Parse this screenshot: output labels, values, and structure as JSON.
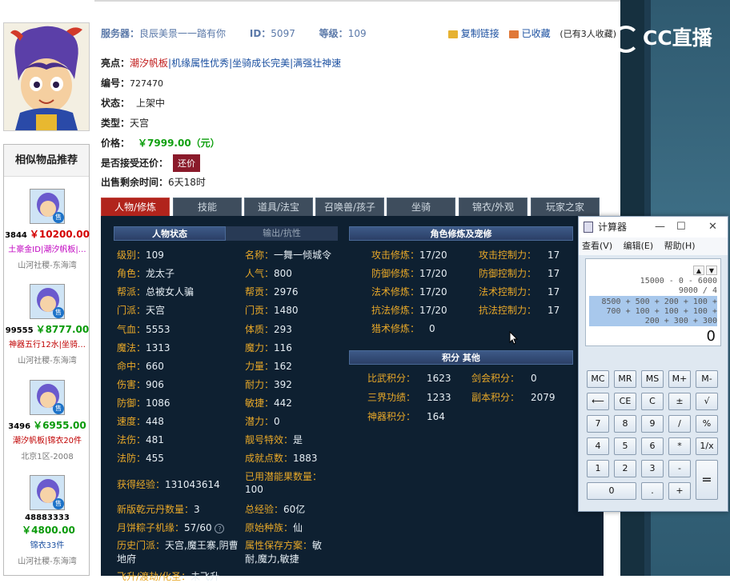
{
  "header": {
    "server_label": "服务器：",
    "server_value": "良辰美景一一踏有你",
    "id_label": "ID：",
    "id_value": "5097",
    "level_label": "等级：",
    "level_value": "109",
    "copy_link": "复制链接",
    "favorited": "已收藏",
    "fav_count": "(已有3人收藏)"
  },
  "info": {
    "highlights_label": "亮点：",
    "highlights_value_1": "潮汐帆板",
    "highlights_value_2": "|机缘属性优秀|坐骑成长完美|满强壮神速",
    "number_label": "编号：",
    "number_value": "727470",
    "status_label": "状态：",
    "status_value": "上架中",
    "type_label": "类型：",
    "type_value": "天宫",
    "price_label": "价格：",
    "price_value": "￥7999.00（元）",
    "bargain_label": "是否接受还价：",
    "bargain_button": "还价",
    "remaining_label": "出售剩余时间：",
    "remaining_value": "6天18时"
  },
  "similar": {
    "title": "相似物品推荐",
    "items": [
      {
        "id": "3844",
        "price": "￥10200.00",
        "tags": "土豪金ID|潮汐帆板|…",
        "server": "山河社稷-东海湾"
      },
      {
        "id": "99555",
        "price": "￥8777.00",
        "tags": "神器五行12水|坐骑…",
        "server": "山河社稷-东海湾"
      },
      {
        "id": "3496",
        "price": "￥6955.00",
        "tags": "潮汐帆板|锦衣20件",
        "server": "北京1区-2008"
      },
      {
        "id": "48883333",
        "price": "￥4800.00",
        "tags": "锦衣33件",
        "server": "山河社稷-东海湾"
      }
    ],
    "badge": "售"
  },
  "tabs": [
    "人物/修炼",
    "技能",
    "道具/法宝",
    "召唤兽/孩子",
    "坐骑",
    "锦衣/外观",
    "玩家之家"
  ],
  "char_tabs": {
    "main": "人物状态",
    "sub": "输出/抗性"
  },
  "stats_left": [
    {
      "k": "级别：",
      "v": "109"
    },
    {
      "k": "角色：",
      "v": "龙太子"
    },
    {
      "k": "帮派：",
      "v": "总被女人骗"
    },
    {
      "k": "门派：",
      "v": "天宫"
    },
    {
      "k": "气血：",
      "v": "5553"
    },
    {
      "k": "魔法：",
      "v": "1313"
    },
    {
      "k": "命中：",
      "v": "660"
    },
    {
      "k": "伤害：",
      "v": "906"
    },
    {
      "k": "防御：",
      "v": "1086"
    },
    {
      "k": "速度：",
      "v": "448"
    },
    {
      "k": "法伤：",
      "v": "481"
    },
    {
      "k": "法防：",
      "v": "455"
    }
  ],
  "stats_mid": [
    {
      "k": "名称：",
      "v": "一舞一倾城令"
    },
    {
      "k": "人气：",
      "v": "800"
    },
    {
      "k": "帮贡：",
      "v": "2976"
    },
    {
      "k": "门贡：",
      "v": "1480"
    },
    {
      "k": "体质：",
      "v": "293"
    },
    {
      "k": "魔力：",
      "v": "116"
    },
    {
      "k": "力量：",
      "v": "162"
    },
    {
      "k": "耐力：",
      "v": "392"
    },
    {
      "k": "敏捷：",
      "v": "442"
    },
    {
      "k": "潜力：",
      "v": "0"
    },
    {
      "k": "靓号特效：",
      "v": "是"
    },
    {
      "k": "成就点数：",
      "v": "1883"
    }
  ],
  "extra": {
    "exp_label": "获得经验：",
    "exp_value": "131043614",
    "potential_label": "已用潜能果数量：",
    "potential_value": "100",
    "qianyuan_label": "新版乾元丹数量：",
    "qianyuan_value": "3",
    "total_exp_label": "总经验：",
    "total_exp_value": "60亿",
    "zongzi_label": "月饼粽子机缘：",
    "zongzi_value": "57/60",
    "race_label": "原始种族：",
    "race_value": "仙",
    "history_label": "历史门派：",
    "history_value": "天宫,魔王寨,阴曹地府",
    "attr_label": "属性保存方案：",
    "attr_value": "敏耐,魔力,敏捷",
    "cut_label": "飞升/渡劫/化圣：",
    "cut_value": "未飞升"
  },
  "cultivation": {
    "title": "角色修炼及宠修",
    "rows": [
      {
        "k1": "攻击修炼：",
        "v1": "17/20",
        "k2": "攻击控制力：",
        "v2": "17"
      },
      {
        "k1": "防御修炼：",
        "v1": "17/20",
        "k2": "防御控制力：",
        "v2": "17"
      },
      {
        "k1": "法术修炼：",
        "v1": "17/20",
        "k2": "法术控制力：",
        "v2": "17"
      },
      {
        "k1": "抗法修炼：",
        "v1": "17/20",
        "k2": "抗法控制力：",
        "v2": "17"
      },
      {
        "k1": "猎术修炼：",
        "v1": "0",
        "k2": "",
        "v2": ""
      }
    ]
  },
  "score": {
    "title": "积分  其他",
    "rows": [
      {
        "k1": "比武积分：",
        "v1": "1623",
        "k2": "剑会积分：",
        "v2": "0"
      },
      {
        "k1": "三界功绩：",
        "v1": "1233",
        "k2": "副本积分：",
        "v2": "2079"
      },
      {
        "k1": "神器积分：",
        "v1": "164",
        "k2": "",
        "v2": ""
      }
    ]
  },
  "calculator": {
    "title": "计算器",
    "menu": [
      "查看(V)",
      "编辑(E)",
      "帮助(H)"
    ],
    "history_1": "15000 - 0 - 6000",
    "history_2": "9000 / 4",
    "history_3": "8500 + 500 + 200 + 100 +",
    "history_4": "700 + 100 + 100 + 100 +",
    "history_5": "200 + 300 + 300",
    "result": "0",
    "keys": [
      "MC",
      "MR",
      "MS",
      "M+",
      "M-",
      "⟵",
      "CE",
      "C",
      "±",
      "√",
      "7",
      "8",
      "9",
      "/",
      "%",
      "4",
      "5",
      "6",
      "*",
      "1/x",
      "1",
      "2",
      "3",
      "-",
      "=",
      "0",
      ".",
      "+"
    ]
  },
  "logo": {
    "text": "CC直播"
  },
  "colors": {
    "accent_red": "#b1241c",
    "panel_dark": "#0e2031",
    "label_orange": "#e8a828",
    "price_green": "#10a010"
  }
}
